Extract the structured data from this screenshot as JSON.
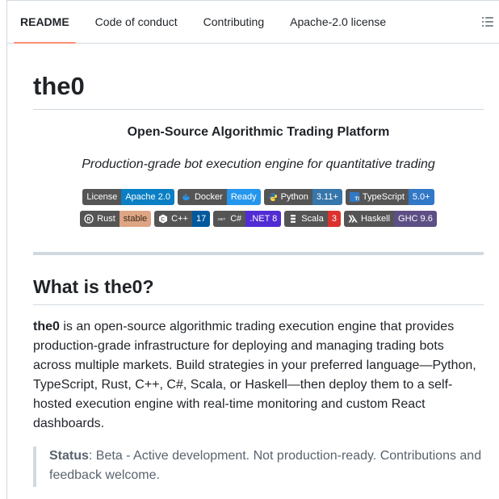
{
  "tabs": [
    {
      "label": "README",
      "active": true
    },
    {
      "label": "Code of conduct",
      "active": false
    },
    {
      "label": "Contributing",
      "active": false
    },
    {
      "label": "Apache-2.0 license",
      "active": false
    }
  ],
  "toc_icon": "list-unordered-icon",
  "readme": {
    "title": "the0",
    "subtitle": "Open-Source Algorithmic Trading Platform",
    "tagline": "Production-grade bot execution engine for quantitative trading",
    "badges_row1": [
      {
        "label": "License",
        "value": "Apache 2.0",
        "color": "#0a7fc4",
        "icon": ""
      },
      {
        "label": "Docker",
        "value": "Ready",
        "color": "#2496ed",
        "icon": "docker-icon"
      },
      {
        "label": "Python",
        "value": "3.11+",
        "color": "#3776ab",
        "icon": "python-icon"
      },
      {
        "label": "TypeScript",
        "value": "5.0+",
        "color": "#3178c6",
        "icon": "typescript-icon"
      }
    ],
    "badges_row2": [
      {
        "label": "Rust",
        "value": "stable",
        "color": "#dea584",
        "icon": "rust-icon"
      },
      {
        "label": "C++",
        "value": "17",
        "color": "#00599c",
        "icon": "cplusplus-icon"
      },
      {
        "label": "C#",
        "value": ".NET 8",
        "color": "#512bd4",
        "icon": "dotnet-icon"
      },
      {
        "label": "Scala",
        "value": "3",
        "color": "#dc322f",
        "icon": "scala-icon"
      },
      {
        "label": "Haskell",
        "value": "GHC 9.6",
        "color": "#5d4f85",
        "icon": "haskell-icon"
      }
    ],
    "section_heading": "What is the0?",
    "intro_bold": "the0",
    "intro_text": " is an open-source algorithmic trading execution engine that provides production-grade infrastructure for deploying and managing trading bots across multiple markets. Build strategies in your preferred language—Python, TypeScript, Rust, C++, C#, Scala, or Haskell—then deploy them to a self-hosted execution engine with real-time monitoring and custom React dashboards.",
    "status_label": "Status",
    "status_text": ": Beta - Active development. Not production-ready. Contributions and feedback welcome."
  }
}
